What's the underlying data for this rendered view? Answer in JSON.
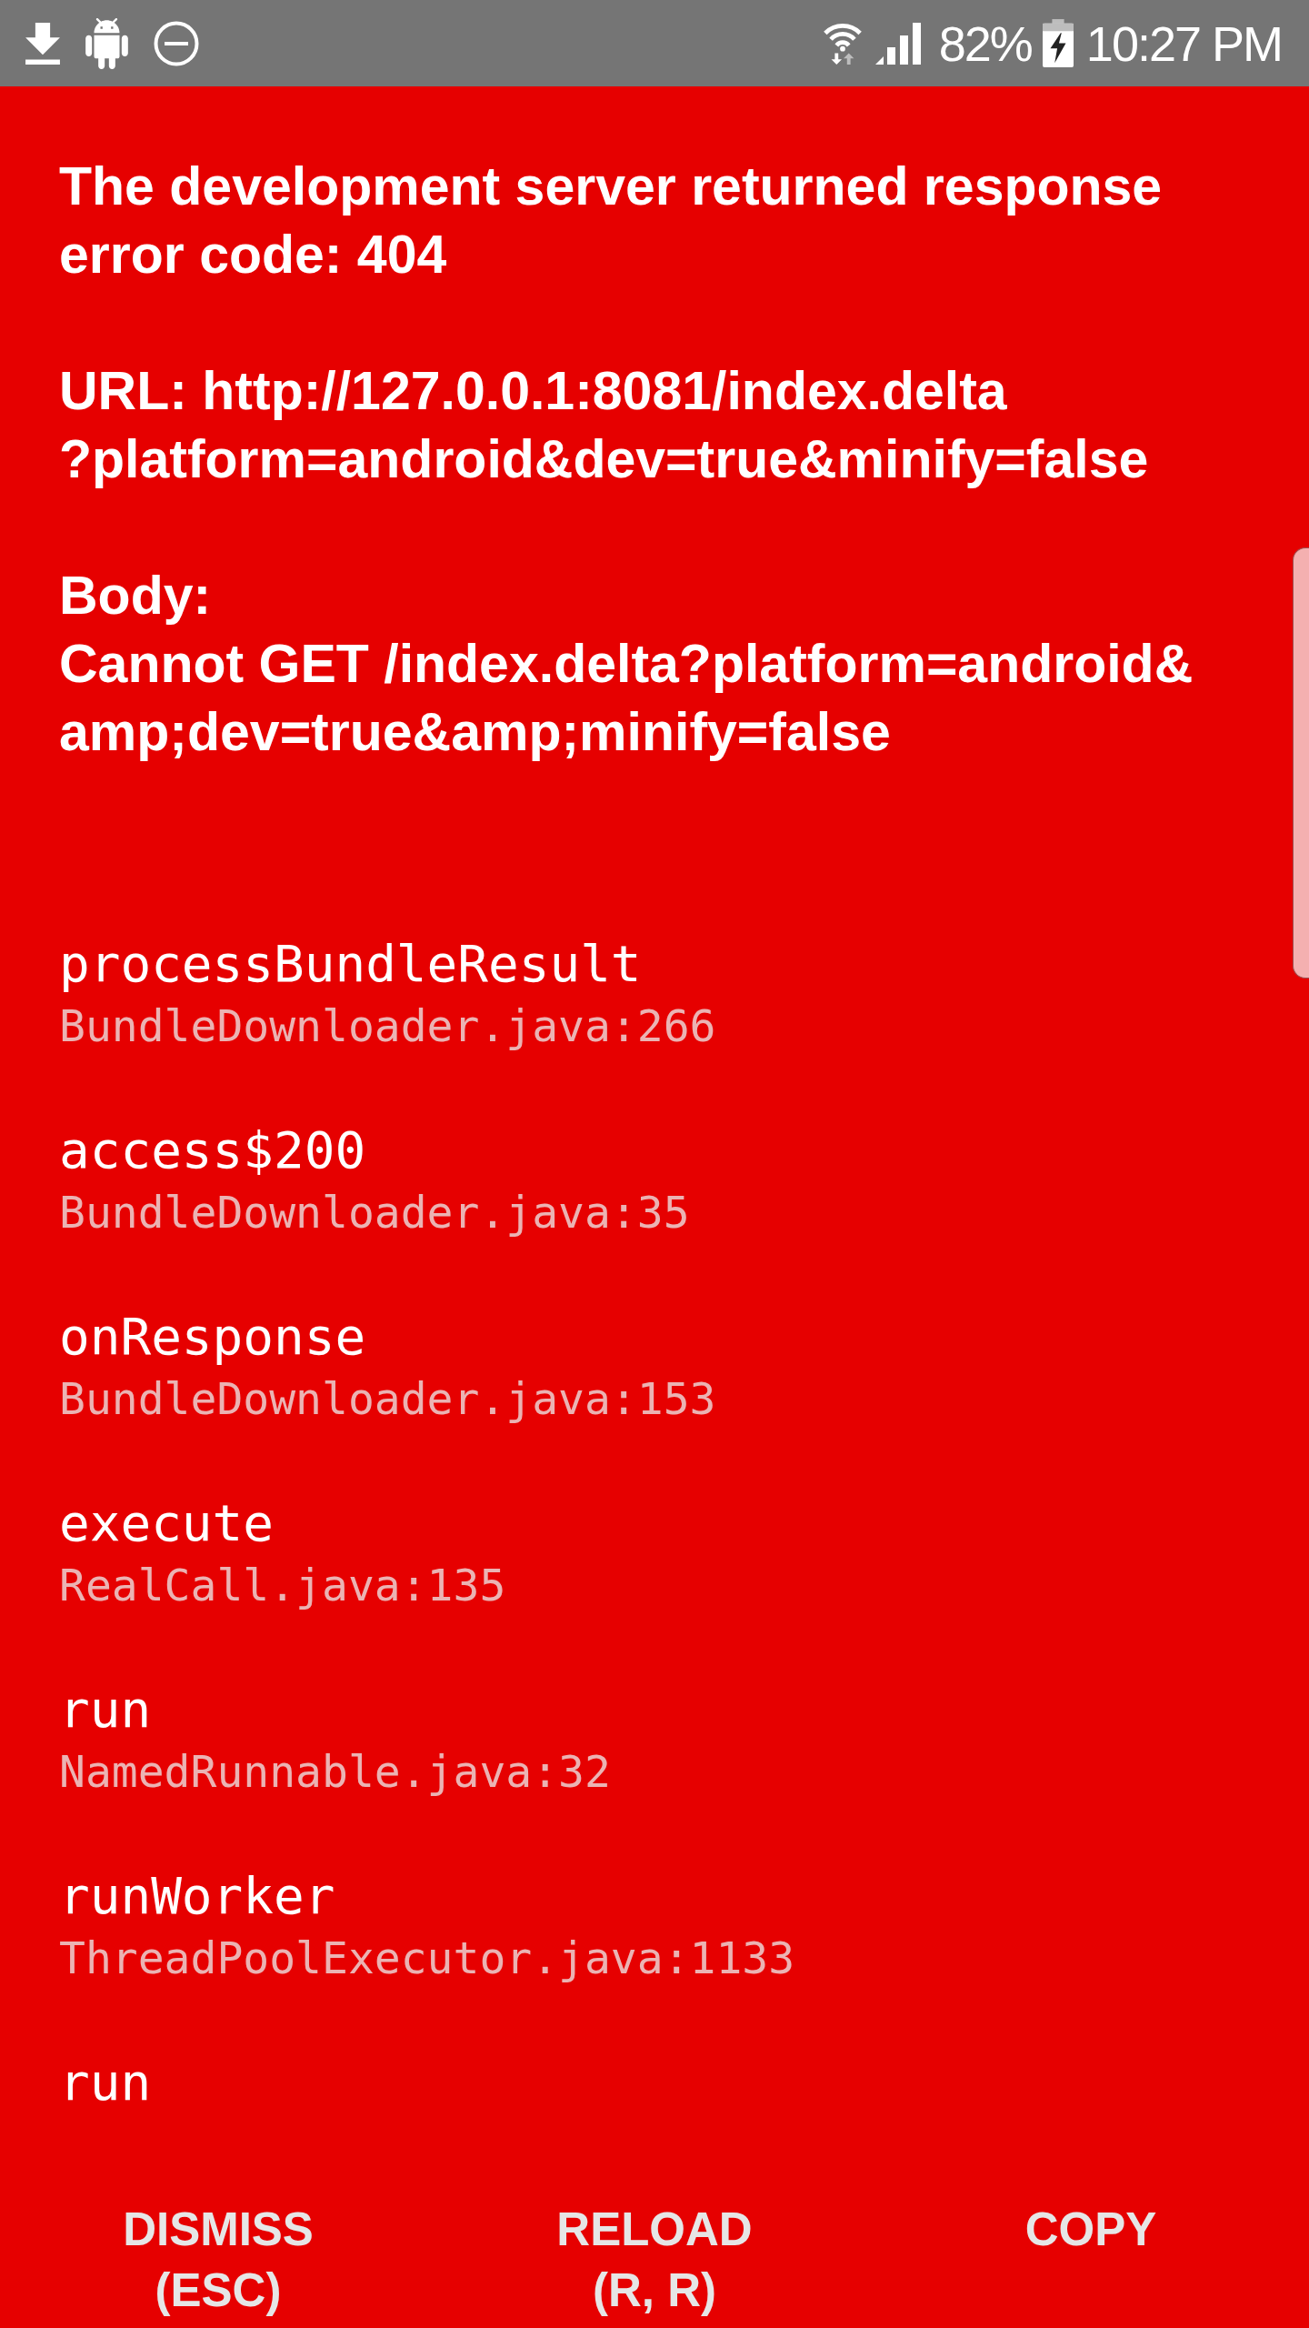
{
  "status_bar": {
    "battery_percent": "82%",
    "charging": true,
    "time": "10:27 PM"
  },
  "error": {
    "paragraphs": [
      {
        "lines": [
          "The development server returned response",
          "error code: 404"
        ]
      },
      {
        "lines": [
          "URL: http://127.0.0.1:8081/index.delta",
          "?platform=android&dev=true&minify=false"
        ]
      },
      {
        "lines": [
          "Body:",
          "Cannot GET /index.delta?platform=android&",
          "amp;dev=true&amp;minify=false"
        ]
      }
    ]
  },
  "stack": [
    {
      "method": "processBundleResult",
      "file": "BundleDownloader.java:266"
    },
    {
      "method": "access$200",
      "file": "BundleDownloader.java:35"
    },
    {
      "method": "onResponse",
      "file": "BundleDownloader.java:153"
    },
    {
      "method": "execute",
      "file": "RealCall.java:135"
    },
    {
      "method": "run",
      "file": "NamedRunnable.java:32"
    },
    {
      "method": "runWorker",
      "file": "ThreadPoolExecutor.java:1133"
    },
    {
      "method": "run"
    }
  ],
  "buttons": [
    {
      "label": "DISMISS",
      "shortcut": "(ESC)"
    },
    {
      "label": "RELOAD",
      "shortcut": "(R, R)"
    },
    {
      "label": "COPY"
    }
  ]
}
